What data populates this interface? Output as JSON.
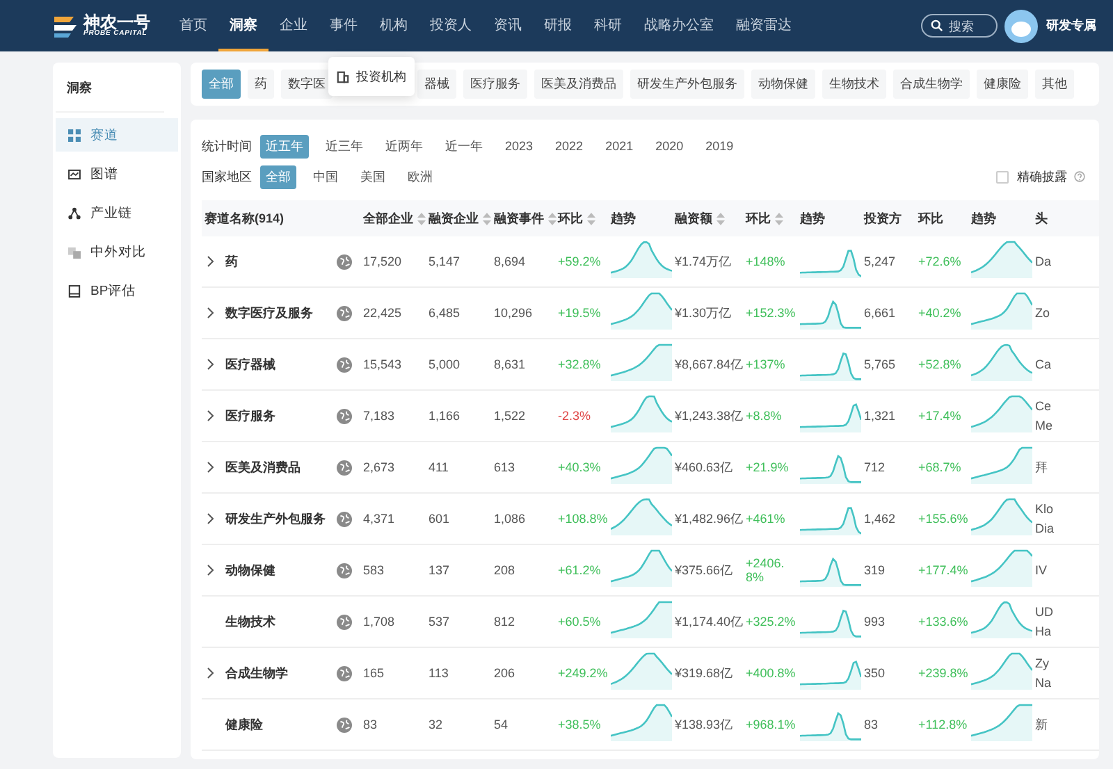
{
  "nav": {
    "logo": {
      "name": "神农一号",
      "sub": "PROBE CAPITAL"
    },
    "items": [
      {
        "label": "首页",
        "selected": false
      },
      {
        "label": "洞察",
        "selected": true
      },
      {
        "label": "企业",
        "selected": false
      },
      {
        "label": "事件",
        "selected": false
      },
      {
        "label": "机构",
        "selected": false
      },
      {
        "label": "投资人",
        "selected": false
      },
      {
        "label": "资讯",
        "selected": false
      },
      {
        "label": "研报",
        "selected": false
      },
      {
        "label": "科研",
        "selected": false
      },
      {
        "label": "战略办公室",
        "selected": false
      },
      {
        "label": "融资雷达",
        "selected": false
      }
    ],
    "search": {
      "placeholder": "搜索"
    },
    "user": "研发专属"
  },
  "dropdown": {
    "items": [
      "投资机构"
    ]
  },
  "sidebar": {
    "title": "洞察",
    "items": [
      {
        "label": "赛道",
        "selected": true
      },
      {
        "label": "图谱",
        "selected": false
      },
      {
        "label": "产业链",
        "selected": false
      },
      {
        "label": "中外对比",
        "selected": false
      },
      {
        "label": "BP评估",
        "selected": false
      }
    ]
  },
  "tags": [
    {
      "label": "全部",
      "selected": true
    },
    {
      "label": "药",
      "selected": false
    },
    {
      "label": "数字医",
      "selected": false
    },
    {
      "label": "器械",
      "selected": false
    },
    {
      "label": "医疗服务",
      "selected": false
    },
    {
      "label": "医美及消费品",
      "selected": false
    },
    {
      "label": "研发生产外包服务",
      "selected": false
    },
    {
      "label": "动物保健",
      "selected": false
    },
    {
      "label": "生物技术",
      "selected": false
    },
    {
      "label": "合成生物学",
      "selected": false
    },
    {
      "label": "健康险",
      "selected": false
    },
    {
      "label": "其他",
      "selected": false
    }
  ],
  "filters": [
    {
      "label": "统计时间",
      "options": [
        {
          "label": "近五年",
          "selected": true
        },
        {
          "label": "近三年",
          "selected": false
        },
        {
          "label": "近两年",
          "selected": false
        },
        {
          "label": "近一年",
          "selected": false
        },
        {
          "label": "2023",
          "selected": false
        },
        {
          "label": "2022",
          "selected": false
        },
        {
          "label": "2021",
          "selected": false
        },
        {
          "label": "2020",
          "selected": false
        },
        {
          "label": "2019",
          "selected": false
        }
      ]
    },
    {
      "label": "国家地区",
      "options": [
        {
          "label": "全部",
          "selected": true
        },
        {
          "label": "中国",
          "selected": false
        },
        {
          "label": "美国",
          "selected": false
        },
        {
          "label": "欧洲",
          "selected": false
        }
      ]
    }
  ],
  "precise": {
    "label": "精确披露",
    "checked": false
  },
  "table": {
    "columns": [
      {
        "label": "赛道名称(914)",
        "sortable": false
      },
      {
        "label": "全部企业",
        "sortable": true
      },
      {
        "label": "融资企业",
        "sortable": true
      },
      {
        "label": "融资事件",
        "sortable": true
      },
      {
        "label": "环比",
        "sortable": true
      },
      {
        "label": "趋势",
        "sortable": false
      },
      {
        "label": "融资额",
        "sortable": true
      },
      {
        "label": "环比",
        "sortable": true
      },
      {
        "label": "趋势",
        "sortable": false
      },
      {
        "label": "投资方",
        "sortable": false
      },
      {
        "label": "环比",
        "sortable": false
      },
      {
        "label": "趋势",
        "sortable": false
      },
      {
        "label": "头",
        "sortable": false
      }
    ],
    "rows": [
      {
        "name": "药",
        "expandable": true,
        "all": "17,520",
        "funded": "5,147",
        "events": "8,694",
        "events_change": {
          "text": "+59.2%",
          "negative": false
        },
        "amount": "¥1.74万亿",
        "amount_change": {
          "text": "+148%",
          "negative": false
        },
        "investors": "5,247",
        "investors_change": {
          "text": "+72.6%",
          "negative": false
        },
        "lead": [
          "Da"
        ]
      },
      {
        "name": "数字医疗及服务",
        "expandable": true,
        "all": "22,425",
        "funded": "6,485",
        "events": "10,296",
        "events_change": {
          "text": "+19.5%",
          "negative": false
        },
        "amount": "¥1.30万亿",
        "amount_change": {
          "text": "+152.3%",
          "negative": false
        },
        "investors": "6,661",
        "investors_change": {
          "text": "+40.2%",
          "negative": false
        },
        "lead": [
          "Zo"
        ]
      },
      {
        "name": "医疗器械",
        "expandable": true,
        "all": "15,543",
        "funded": "5,000",
        "events": "8,631",
        "events_change": {
          "text": "+32.8%",
          "negative": false
        },
        "amount": "¥8,667.84亿",
        "amount_change": {
          "text": "+137%",
          "negative": false
        },
        "investors": "5,765",
        "investors_change": {
          "text": "+52.8%",
          "negative": false
        },
        "lead": [
          "Ca"
        ]
      },
      {
        "name": "医疗服务",
        "expandable": true,
        "all": "7,183",
        "funded": "1,166",
        "events": "1,522",
        "events_change": {
          "text": "-2.3%",
          "negative": true
        },
        "amount": "¥1,243.38亿",
        "amount_change": {
          "text": "+8.8%",
          "negative": false
        },
        "investors": "1,321",
        "investors_change": {
          "text": "+17.4%",
          "negative": false
        },
        "lead": [
          "Ce",
          "Me"
        ]
      },
      {
        "name": "医美及消费品",
        "expandable": true,
        "all": "2,673",
        "funded": "411",
        "events": "613",
        "events_change": {
          "text": "+40.3%",
          "negative": false
        },
        "amount": "¥460.63亿",
        "amount_change": {
          "text": "+21.9%",
          "negative": false
        },
        "investors": "712",
        "investors_change": {
          "text": "+68.7%",
          "negative": false
        },
        "lead": [
          "拜"
        ]
      },
      {
        "name": "研发生产外包服务",
        "expandable": true,
        "all": "4,371",
        "funded": "601",
        "events": "1,086",
        "events_change": {
          "text": "+108.8%",
          "negative": false
        },
        "amount": "¥1,482.96亿",
        "amount_change": {
          "text": "+461%",
          "negative": false
        },
        "investors": "1,462",
        "investors_change": {
          "text": "+155.6%",
          "negative": false
        },
        "lead": [
          "Klo",
          "Dia"
        ]
      },
      {
        "name": "动物保健",
        "expandable": true,
        "all": "583",
        "funded": "137",
        "events": "208",
        "events_change": {
          "text": "+61.2%",
          "negative": false
        },
        "amount": "¥375.66亿",
        "amount_change": {
          "text": "+2406.8%",
          "negative": false
        },
        "investors": "319",
        "investors_change": {
          "text": "+177.4%",
          "negative": false
        },
        "lead": [
          "IV"
        ]
      },
      {
        "name": "生物技术",
        "expandable": false,
        "all": "1,708",
        "funded": "537",
        "events": "812",
        "events_change": {
          "text": "+60.5%",
          "negative": false
        },
        "amount": "¥1,174.40亿",
        "amount_change": {
          "text": "+325.2%",
          "negative": false
        },
        "investors": "993",
        "investors_change": {
          "text": "+133.6%",
          "negative": false
        },
        "lead": [
          "UD",
          "Ha"
        ]
      },
      {
        "name": "合成生物学",
        "expandable": true,
        "all": "165",
        "funded": "113",
        "events": "206",
        "events_change": {
          "text": "+249.2%",
          "negative": false
        },
        "amount": "¥319.68亿",
        "amount_change": {
          "text": "+400.8%",
          "negative": false
        },
        "investors": "350",
        "investors_change": {
          "text": "+239.8%",
          "negative": false
        },
        "lead": [
          "Zy",
          "Na"
        ]
      },
      {
        "name": "健康险",
        "expandable": false,
        "all": "83",
        "funded": "32",
        "events": "54",
        "events_change": {
          "text": "+38.5%",
          "negative": false
        },
        "amount": "¥138.93亿",
        "amount_change": {
          "text": "+968.1%",
          "negative": false
        },
        "investors": "83",
        "investors_change": {
          "text": "+112.8%",
          "negative": false
        },
        "lead": [
          "新"
        ]
      }
    ]
  }
}
